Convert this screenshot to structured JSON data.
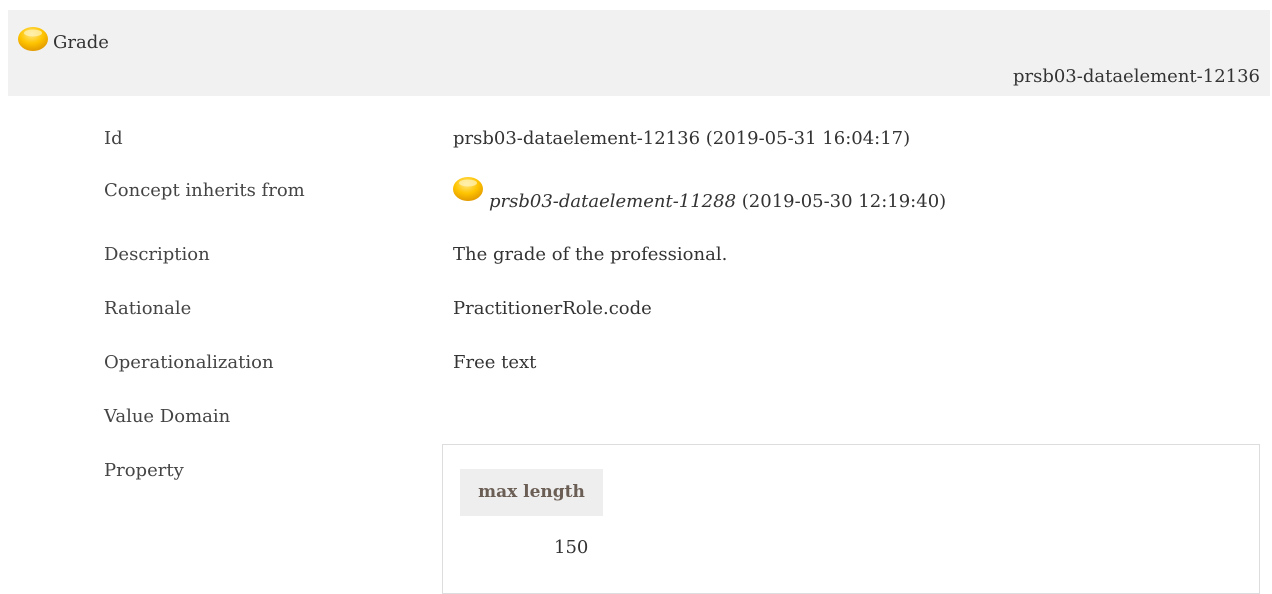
{
  "header": {
    "title": "Grade",
    "id": "prsb03-dataelement-12136",
    "icon": "concept-bullet-icon",
    "icon_color": "#f5b800"
  },
  "details": [
    {
      "label": "Id",
      "value": "prsb03-dataelement-12136 (2019-05-31 16:04:17)"
    },
    {
      "label": "Concept inherits from",
      "value_link": "prsb03-dataelement-11288",
      "value_suffix": "(2019-05-30 12:19:40)"
    },
    {
      "label": "Description",
      "value": "The grade of the professional."
    },
    {
      "label": "Rationale",
      "value": "PractitionerRole.code"
    },
    {
      "label": "Operationalization",
      "value": "Free text"
    },
    {
      "label": "Value Domain",
      "value": ""
    },
    {
      "label": "Property",
      "value": ""
    }
  ],
  "property_table": {
    "header": "max length",
    "value": "150"
  }
}
